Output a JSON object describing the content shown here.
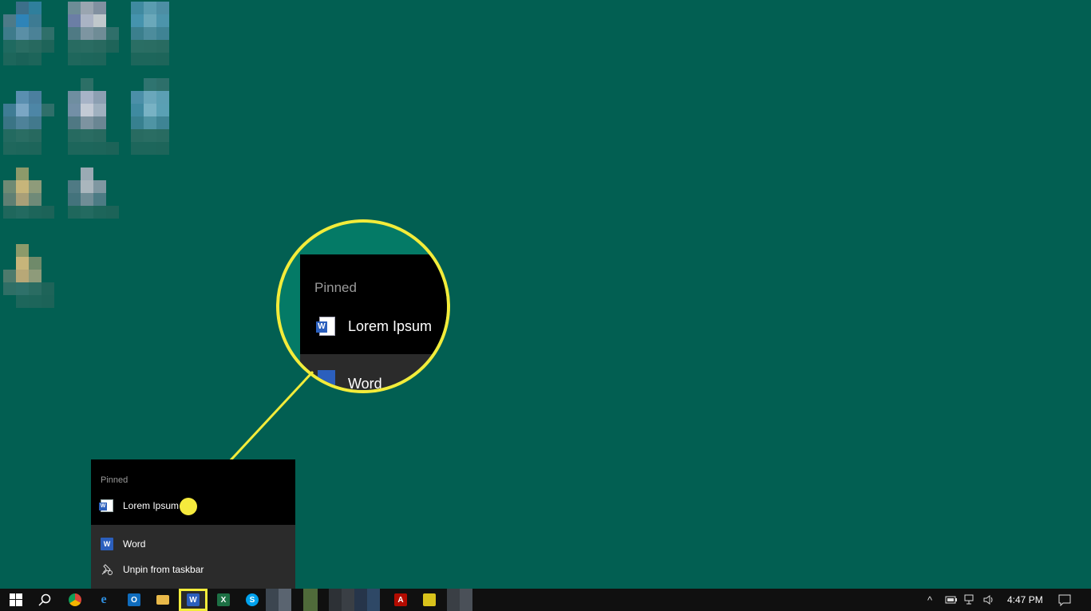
{
  "jumplist": {
    "pinned_heading": "Pinned",
    "pinned_item": "Lorem Ipsum",
    "app_item": "Word",
    "unpin_item": "Unpin from taskbar"
  },
  "callout": {
    "heading": "Pinned",
    "item": "Lorem Ipsum",
    "app": "Word",
    "color": "#f3ec3a"
  },
  "taskbar": {
    "clock": "4:47 PM",
    "icons": [
      "windows-start-icon",
      "search-icon",
      "chrome-icon",
      "edge-icon",
      "outlook-icon",
      "file-explorer-icon",
      "word-icon",
      "excel-icon",
      "skype-icon",
      "acrobat-icon",
      "sticky-notes-icon"
    ]
  },
  "colors": {
    "desktop": "#025f52",
    "taskbar": "#101010",
    "word_blue": "#2b5fbd",
    "highlight": "#f3ec3a"
  }
}
